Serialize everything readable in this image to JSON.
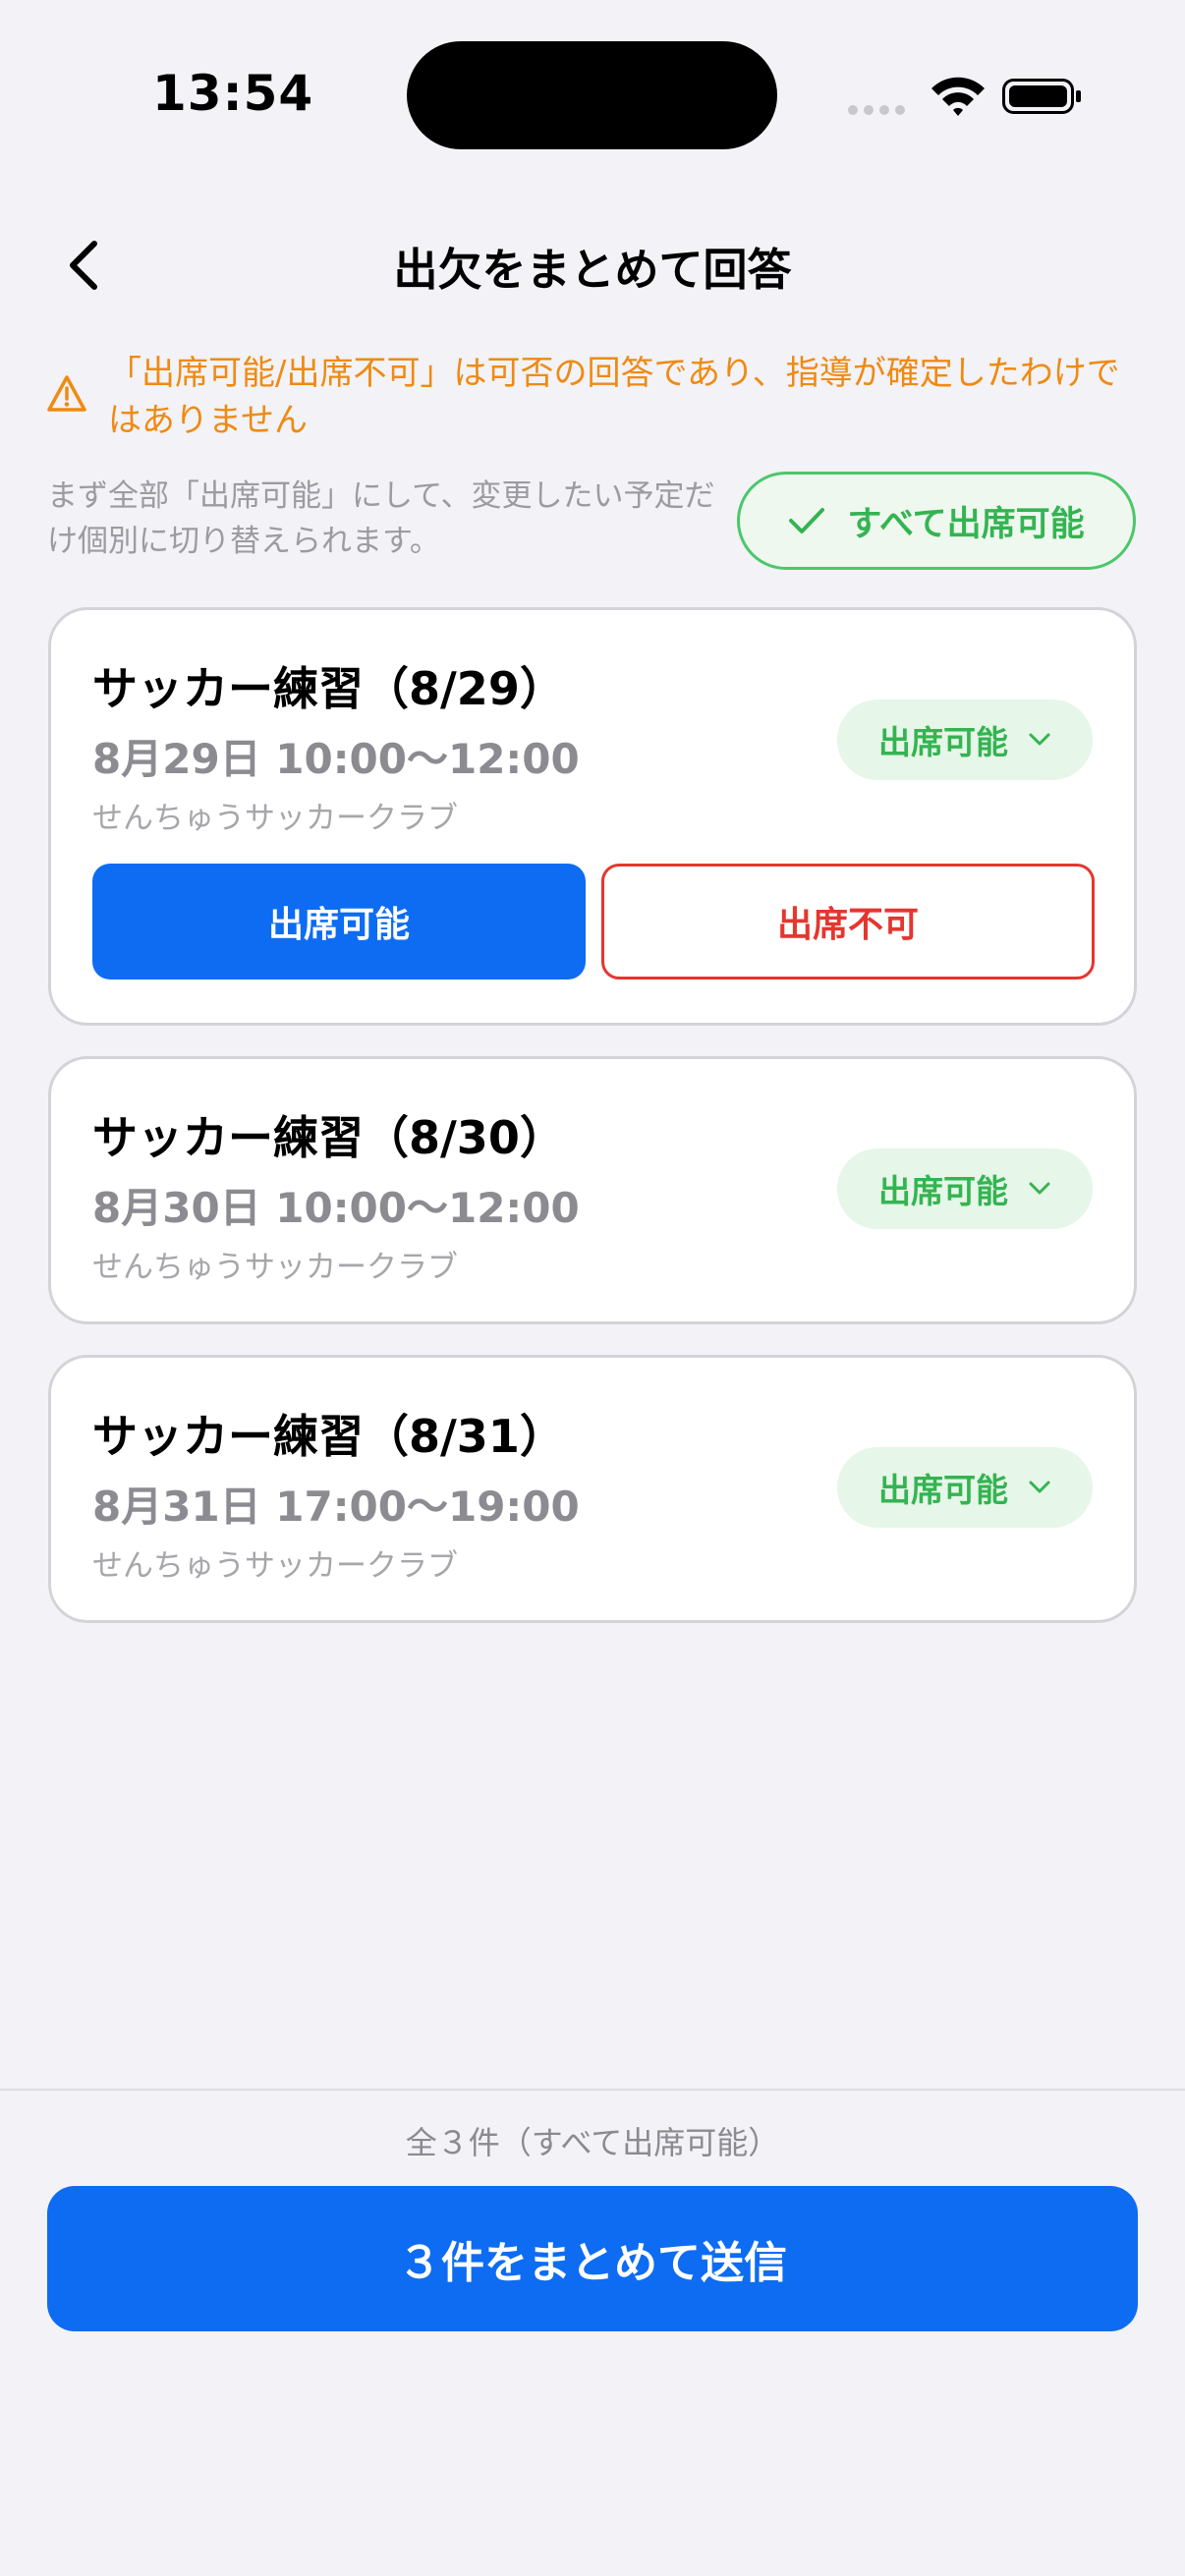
{
  "status_bar": {
    "time": "13:54"
  },
  "nav": {
    "title": "出欠をまとめて回答"
  },
  "warning": {
    "text": "「出席可能/出席不可」は可否の回答であり、指導が確定したわけではありません"
  },
  "helper": {
    "text": "まず全部「出席可能」にして、変更したい予定だけ個別に切り替えられます。",
    "all_available_label": "すべて出席可能"
  },
  "events": [
    {
      "title": "サッカー練習（8/29）",
      "datetime": "8月29日 10:00〜12:00",
      "club": "せんちゅうサッカークラブ",
      "status": "出席可能",
      "expanded": true,
      "available_label": "出席可能",
      "unavailable_label": "出席不可"
    },
    {
      "title": "サッカー練習（8/30）",
      "datetime": "8月30日 10:00〜12:00",
      "club": "せんちゅうサッカークラブ",
      "status": "出席可能",
      "expanded": false
    },
    {
      "title": "サッカー練習（8/31）",
      "datetime": "8月31日 17:00〜19:00",
      "club": "せんちゅうサッカークラブ",
      "status": "出席可能",
      "expanded": false
    }
  ],
  "footer": {
    "summary": "全３件（すべて出席可能）",
    "submit_label": "３件をまとめて送信"
  },
  "colors": {
    "accent_blue": "#0d6cf2",
    "success_green": "#34b451",
    "warning_orange": "#ef8a12",
    "danger_red": "#e5362f"
  }
}
